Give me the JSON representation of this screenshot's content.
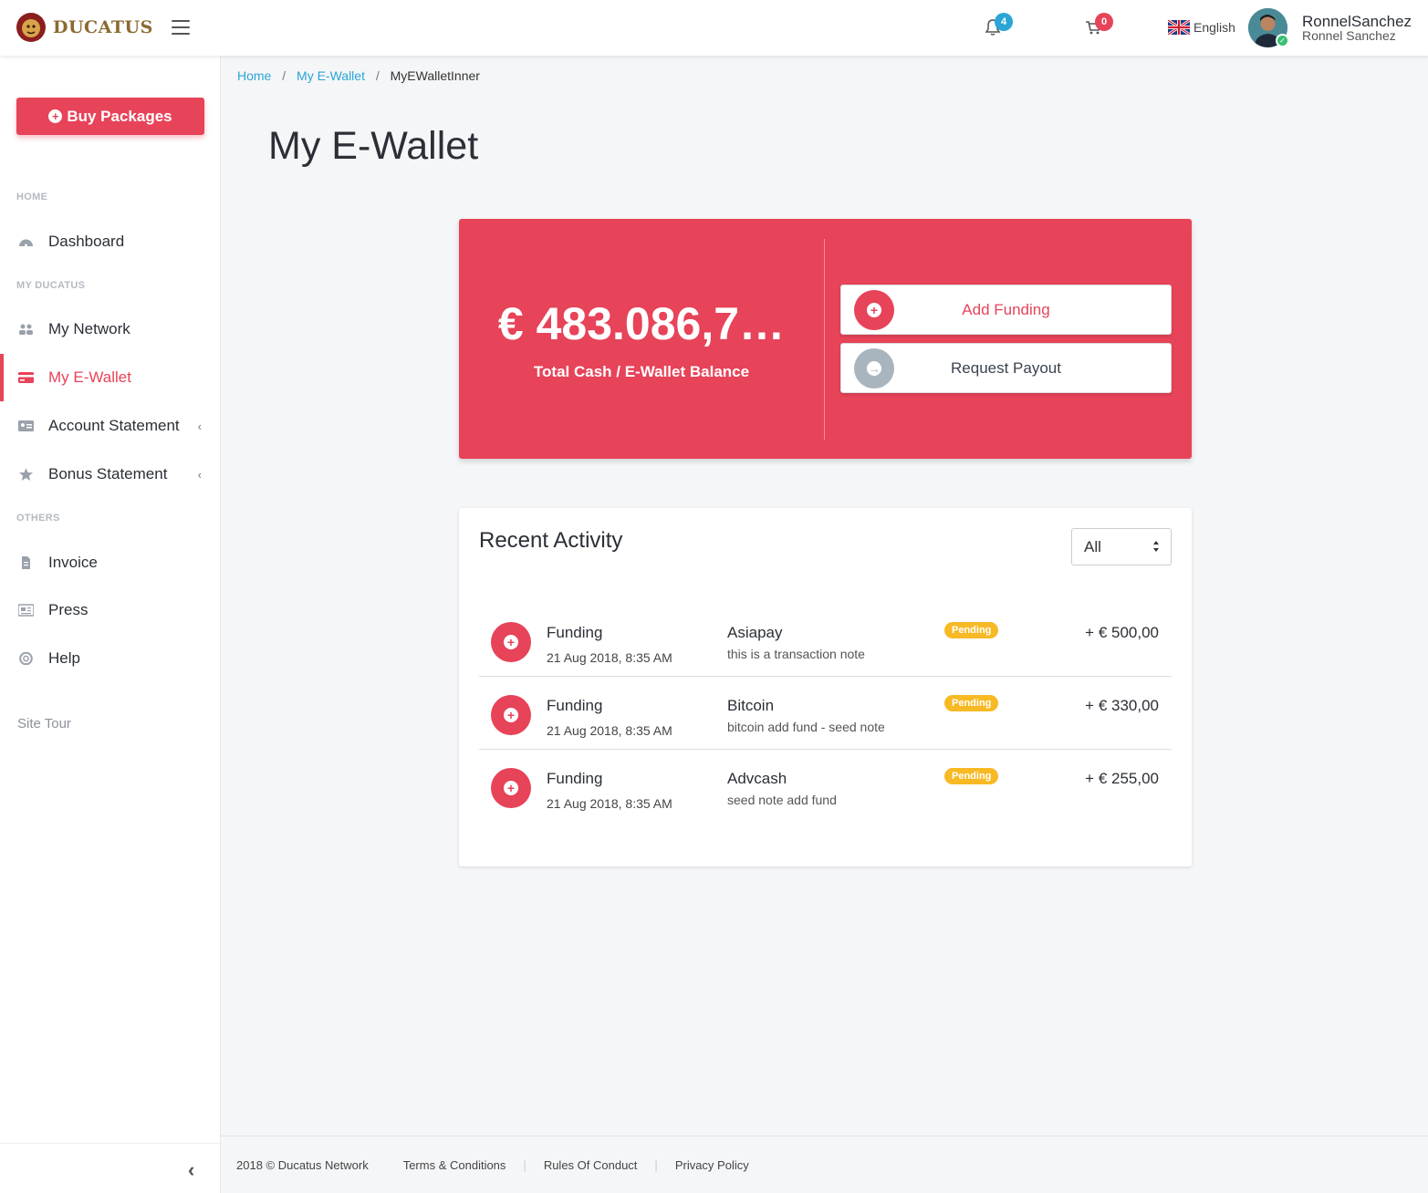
{
  "header": {
    "brand": "DUCATUS",
    "notifications_count": "4",
    "cart_count": "0",
    "language": "English",
    "username": "RonnelSanchez",
    "full_name": "Ronnel Sanchez"
  },
  "sidebar": {
    "buy_packages_label": "Buy Packages",
    "sections": {
      "home": "HOME",
      "my_ducatus": "MY DUCATUS",
      "others": "OTHERS"
    },
    "items": [
      {
        "label": "Dashboard",
        "icon": "dashboard-icon"
      },
      {
        "label": "My Network",
        "icon": "users-icon"
      },
      {
        "label": "My E-Wallet",
        "icon": "credit-card-icon",
        "active": true
      },
      {
        "label": "Account Statement",
        "icon": "id-card-icon",
        "has_submenu": true
      },
      {
        "label": "Bonus Statement",
        "icon": "star-icon",
        "has_submenu": true
      },
      {
        "label": "Invoice",
        "icon": "file-icon"
      },
      {
        "label": "Press",
        "icon": "newspaper-icon"
      },
      {
        "label": "Help",
        "icon": "life-ring-icon"
      }
    ],
    "site_tour_label": "Site Tour",
    "active_color": "#e74359"
  },
  "breadcrumb": {
    "home": "Home",
    "wallet": "My E-Wallet",
    "current": "MyEWalletInner"
  },
  "page_title": "My E-Wallet",
  "wallet": {
    "balance": "€ 483.086,7…",
    "balance_label": "Total Cash / E-Wallet Balance",
    "add_funding_label": "Add Funding",
    "request_payout_label": "Request Payout",
    "card_color": "#e74359"
  },
  "activity": {
    "title": "Recent Activity",
    "filter_value": "All",
    "rows": [
      {
        "type": "Funding",
        "date": "21 Aug 2018, 8:35 AM",
        "method": "Asiapay",
        "note": "this is a transaction note",
        "status": "Pending",
        "amount": "+ € 500,00"
      },
      {
        "type": "Funding",
        "date": "21 Aug 2018, 8:35 AM",
        "method": "Bitcoin",
        "note": "bitcoin add fund - seed note",
        "status": "Pending",
        "amount": "+ € 330,00"
      },
      {
        "type": "Funding",
        "date": "21 Aug 2018, 8:35 AM",
        "method": "Advcash",
        "note": "seed note add fund",
        "status": "Pending",
        "amount": "+ € 255,00"
      }
    ],
    "status_color": "#f7b924"
  },
  "footer": {
    "copyright": "2018 © Ducatus Network",
    "terms": "Terms & Conditions",
    "rules": "Rules Of Conduct",
    "privacy": "Privacy Policy"
  }
}
